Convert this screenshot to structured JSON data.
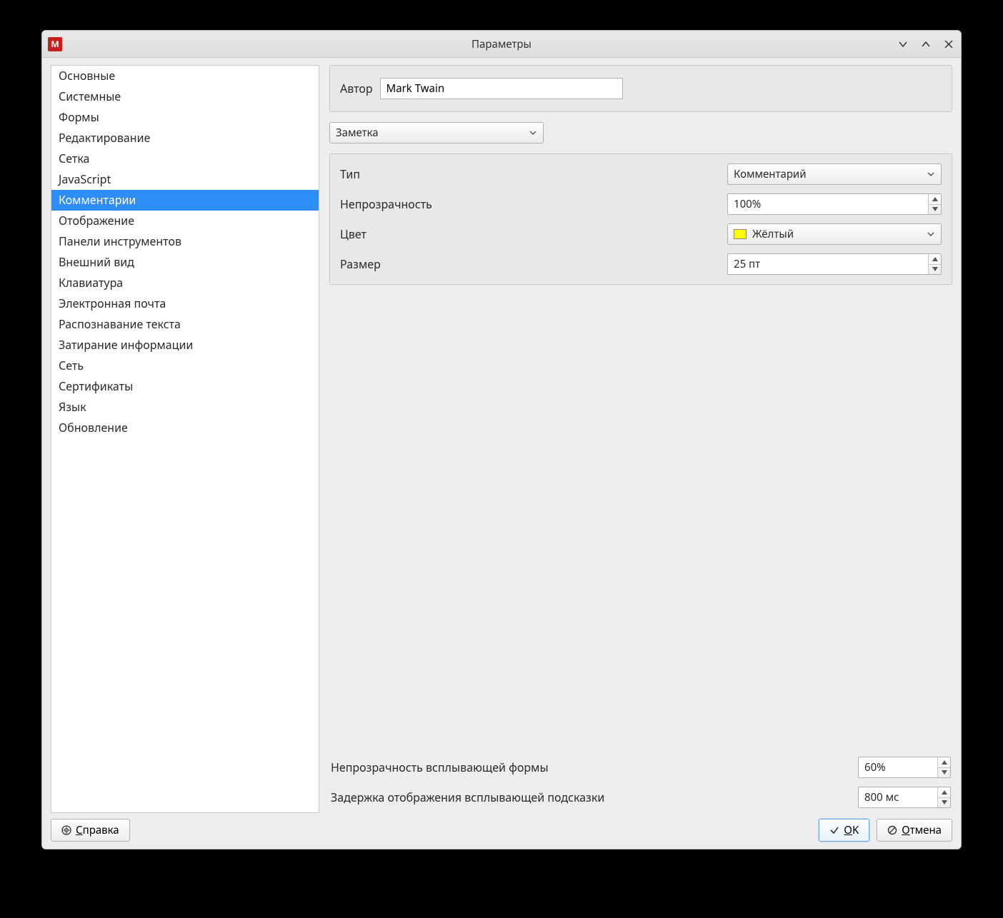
{
  "window": {
    "title": "Параметры"
  },
  "sidebar": {
    "items": [
      "Основные",
      "Системные",
      "Формы",
      "Редактирование",
      "Сетка",
      "JavaScript",
      "Комментарии",
      "Отображение",
      "Панели инструментов",
      "Внешний вид",
      "Клавиатура",
      "Электронная почта",
      "Распознавание текста",
      "Затирание информации",
      "Сеть",
      "Сертификаты",
      "Язык",
      "Обновление"
    ],
    "selected_index": 6
  },
  "author": {
    "label": "Автор",
    "value": "Mark Twain"
  },
  "annotation_type_selector": {
    "value": "Заметка"
  },
  "settings": {
    "type": {
      "label": "Тип",
      "value": "Комментарий"
    },
    "opacity": {
      "label": "Непрозрачность",
      "value": "100%"
    },
    "color": {
      "label": "Цвет",
      "value": "Жёлтый",
      "swatch": "#ffff00"
    },
    "size": {
      "label": "Размер",
      "value": "25 пт"
    }
  },
  "popup": {
    "opacity": {
      "label": "Непрозрачность всплывающей формы",
      "value": "60%"
    },
    "delay": {
      "label": "Задержка отображения всплывающей подсказки",
      "value": "800 мс"
    }
  },
  "footer": {
    "help": "Справка",
    "ok": "OK",
    "cancel": "Отмена"
  }
}
